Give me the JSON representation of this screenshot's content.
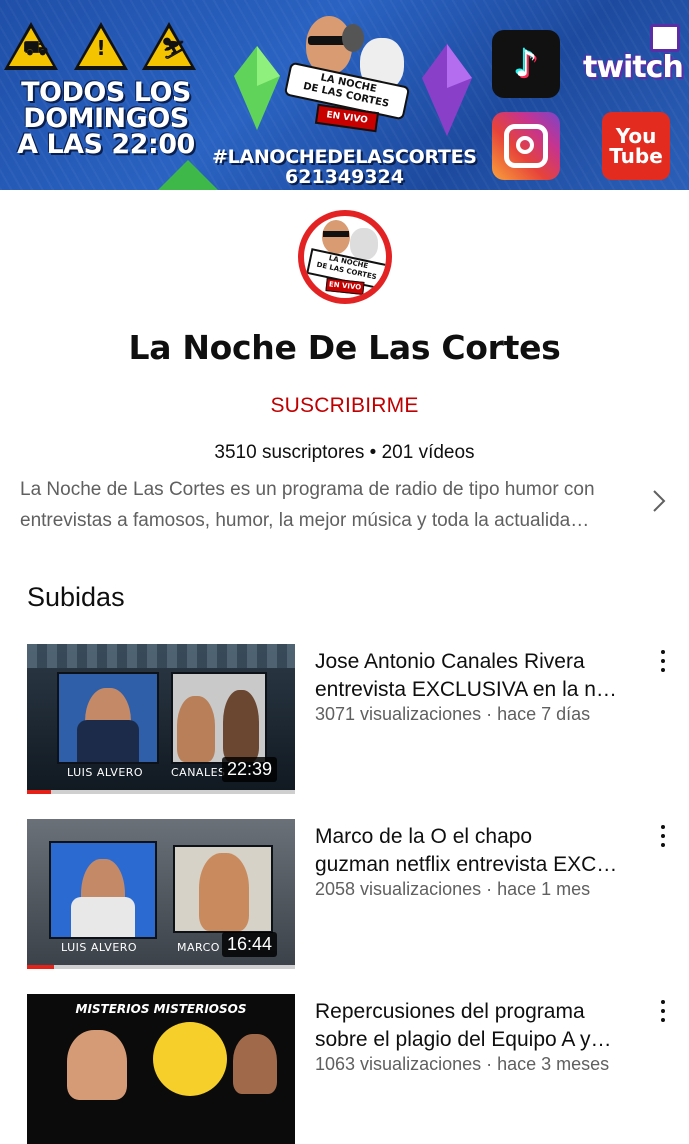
{
  "banner": {
    "schedule_lines": [
      "TODOS LOS",
      "DOMINGOS",
      "A LAS 22:00"
    ],
    "hashtag": "#LANOCHEDELASCORTES",
    "phone": "621349324",
    "logo_ribbon": [
      "LA NOCHE",
      "DE LAS CORTES"
    ],
    "logo_live": "EN VIVO",
    "social": {
      "twitch": "twitch",
      "youtube_top": "You",
      "youtube_bottom": "Tube"
    }
  },
  "channel": {
    "title": "La Noche De Las Cortes",
    "subscribe_label": "SUSCRIBIRME",
    "stats": "3510 suscriptores • 201 vídeos",
    "description_lines": [
      "La Noche de Las Cortes es un programa de radio de tipo humor con",
      "entrevistas a famosos, humor, la mejor música y toda la actualida…"
    ]
  },
  "section_title": "Subidas",
  "videos": [
    {
      "title_lines": [
        "Jose Antonio Canales Rivera",
        "entrevista EXCLUSIVA en la n…"
      ],
      "meta": "3071 visualizaciones · hace 7 días",
      "duration": "22:39",
      "watched_fraction": 0.09,
      "thumb_names": [
        "LUIS ALVERO",
        "CANALES"
      ]
    },
    {
      "title_lines": [
        "Marco de la O el chapo",
        "guzman netflix entrevista EXC…"
      ],
      "meta": "2058 visualizaciones · hace 1 mes",
      "duration": "16:44",
      "watched_fraction": 0.1,
      "thumb_names": [
        "LUIS ALVERO",
        "MARCO"
      ]
    },
    {
      "title_lines": [
        "Repercusiones del programa",
        "sobre el plagio del Equipo A y…"
      ],
      "meta": "1063 visualizaciones · hace 3 meses",
      "thumb_header": "MISTERIOS MISTERIOSOS"
    }
  ],
  "colors": {
    "subscribe": "#c00000",
    "progress": "#e62117",
    "logo_red": "#e32323"
  },
  "icons": {
    "more": "more-vert-icon",
    "expand": "chevron-right-icon"
  }
}
